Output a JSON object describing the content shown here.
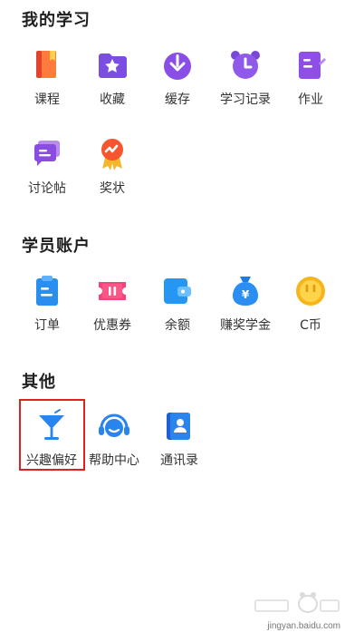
{
  "sections": {
    "study": {
      "title": "我的学习",
      "items": [
        {
          "label": "课程",
          "icon": "book-icon"
        },
        {
          "label": "收藏",
          "icon": "star-folder-icon"
        },
        {
          "label": "缓存",
          "icon": "download-icon"
        },
        {
          "label": "学习记录",
          "icon": "alarm-clock-icon"
        },
        {
          "label": "作业",
          "icon": "homework-icon"
        },
        {
          "label": "讨论帖",
          "icon": "chat-bubble-icon"
        },
        {
          "label": "奖状",
          "icon": "medal-icon"
        }
      ]
    },
    "account": {
      "title": "学员账户",
      "items": [
        {
          "label": "订单",
          "icon": "clipboard-icon"
        },
        {
          "label": "优惠券",
          "icon": "coupon-icon"
        },
        {
          "label": "余额",
          "icon": "wallet-icon"
        },
        {
          "label": "赚奖学金",
          "icon": "money-bag-icon"
        },
        {
          "label": "C币",
          "icon": "coin-icon"
        }
      ]
    },
    "other": {
      "title": "其他",
      "items": [
        {
          "label": "兴趣偏好",
          "icon": "cocktail-glass-icon"
        },
        {
          "label": "帮助中心",
          "icon": "headset-icon"
        },
        {
          "label": "通讯录",
          "icon": "contacts-icon"
        }
      ]
    }
  },
  "watermark": {
    "text": "jingyan.baidu.com"
  }
}
